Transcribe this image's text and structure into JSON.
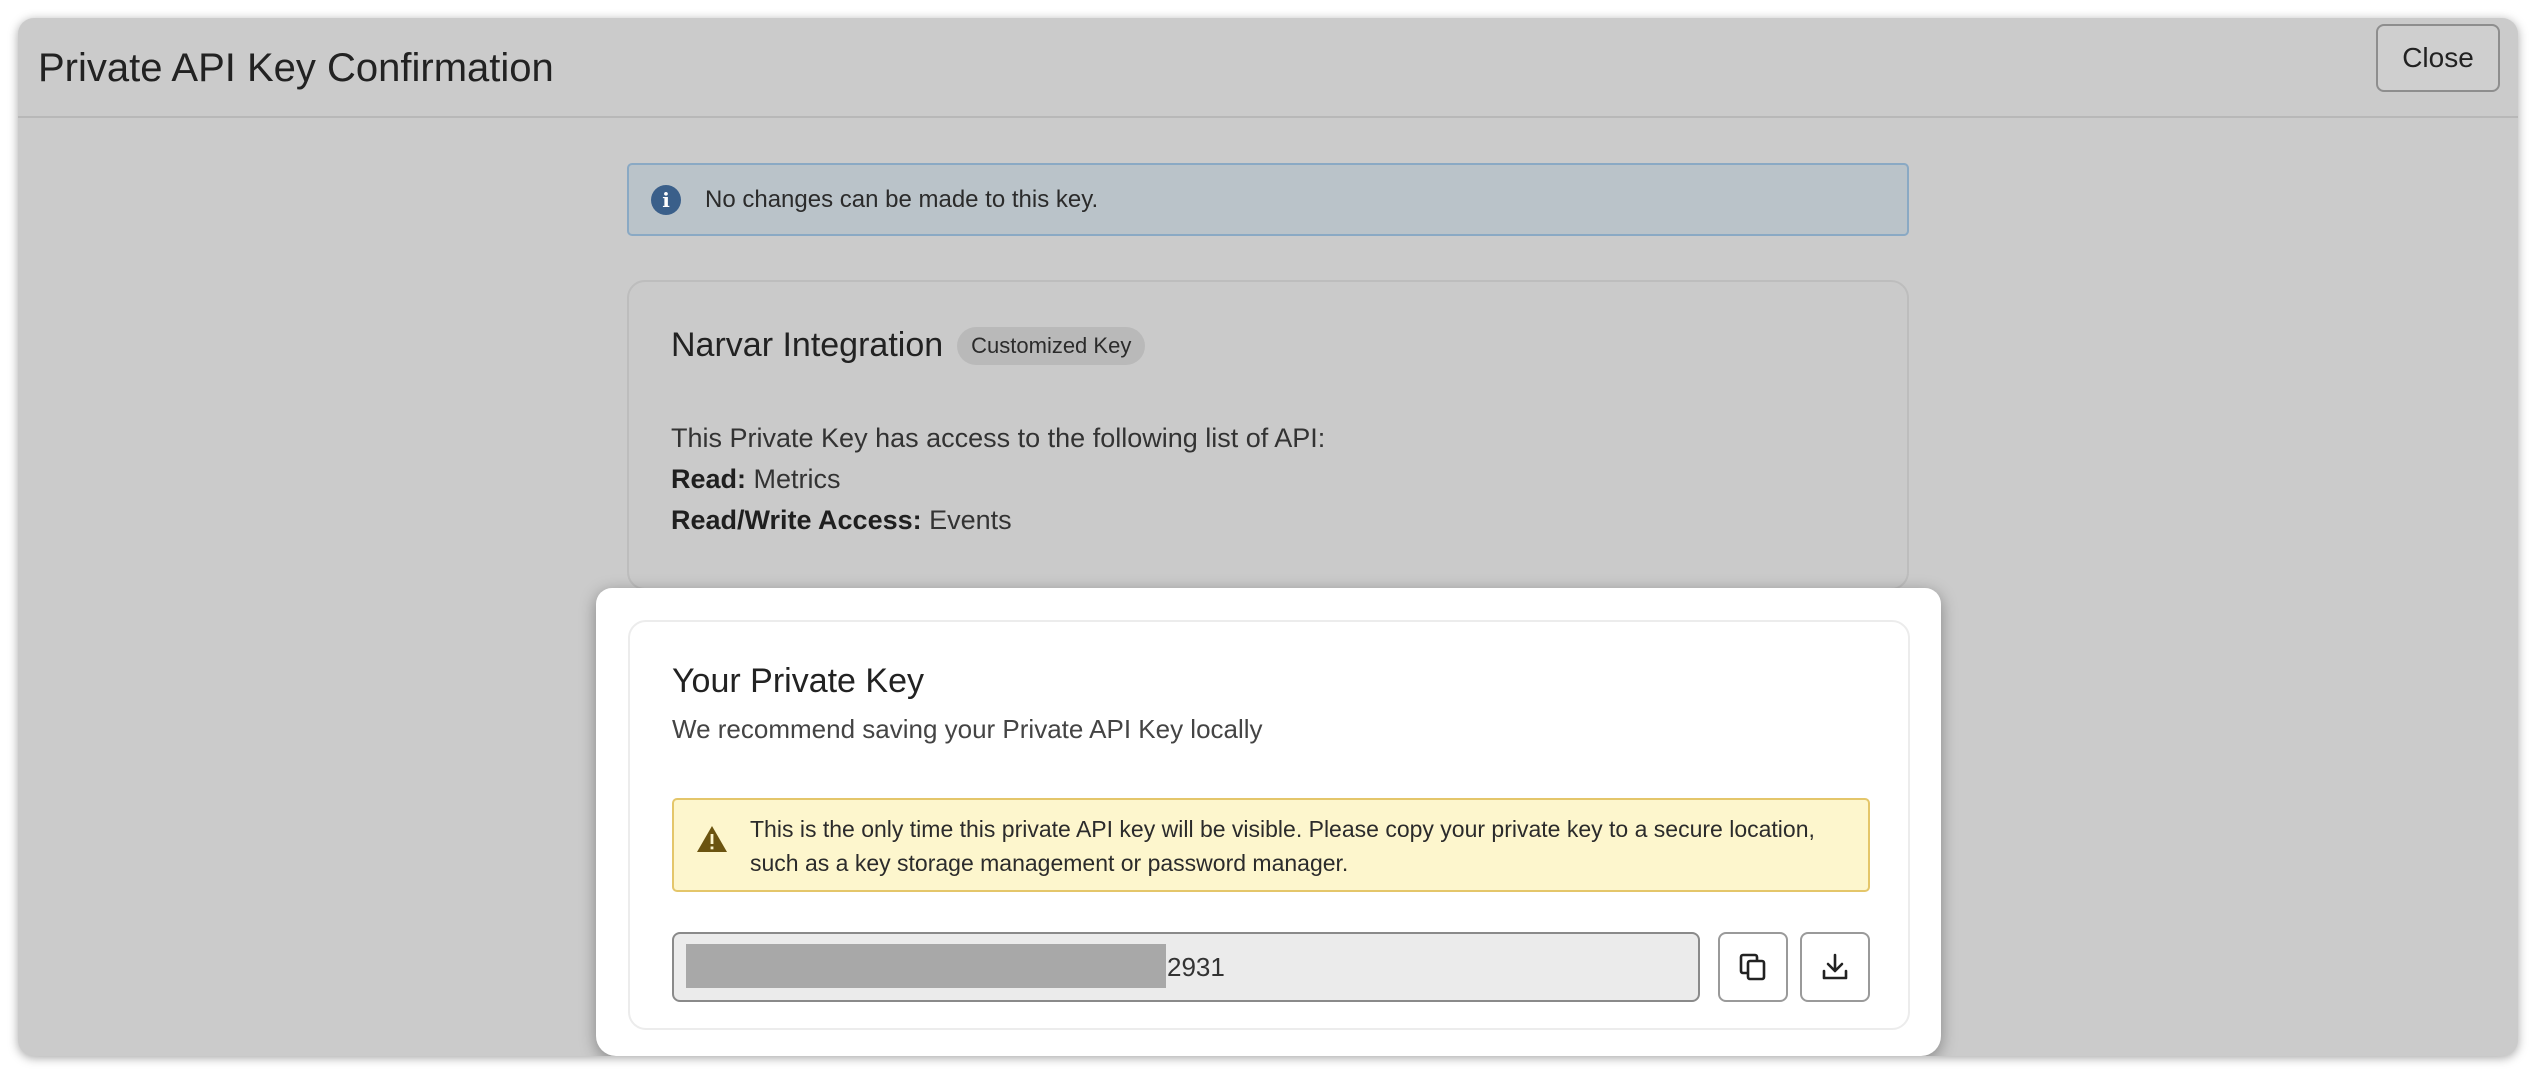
{
  "header": {
    "title": "Private API Key Confirmation",
    "close_label": "Close"
  },
  "info_banner": {
    "icon": "info-icon",
    "text": "No changes can be made to this key."
  },
  "key_card": {
    "title": "Narvar Integration",
    "badge": "Customized Key",
    "intro": "This Private Key has access to the following list of API:",
    "permissions": [
      {
        "label": "Read:",
        "value": "Metrics"
      },
      {
        "label": "Read/Write Access:",
        "value": "Events"
      }
    ]
  },
  "private_key": {
    "title": "Your Private Key",
    "subtitle": "We recommend saving your Private API Key locally",
    "warning_icon": "warning-triangle-icon",
    "warning": "This is the only time this private API key will be visible. Please copy your private key to a secure location, such as a key storage management or password manager.",
    "key_value_visible": "2931",
    "copy_icon": "copy-icon",
    "download_icon": "download-icon"
  },
  "colors": {
    "info_accent": "#3a5f8a",
    "warning_bg": "#fdf6cd",
    "warning_border": "#e4c66a",
    "overlay_bg": "#cbcbcb"
  }
}
